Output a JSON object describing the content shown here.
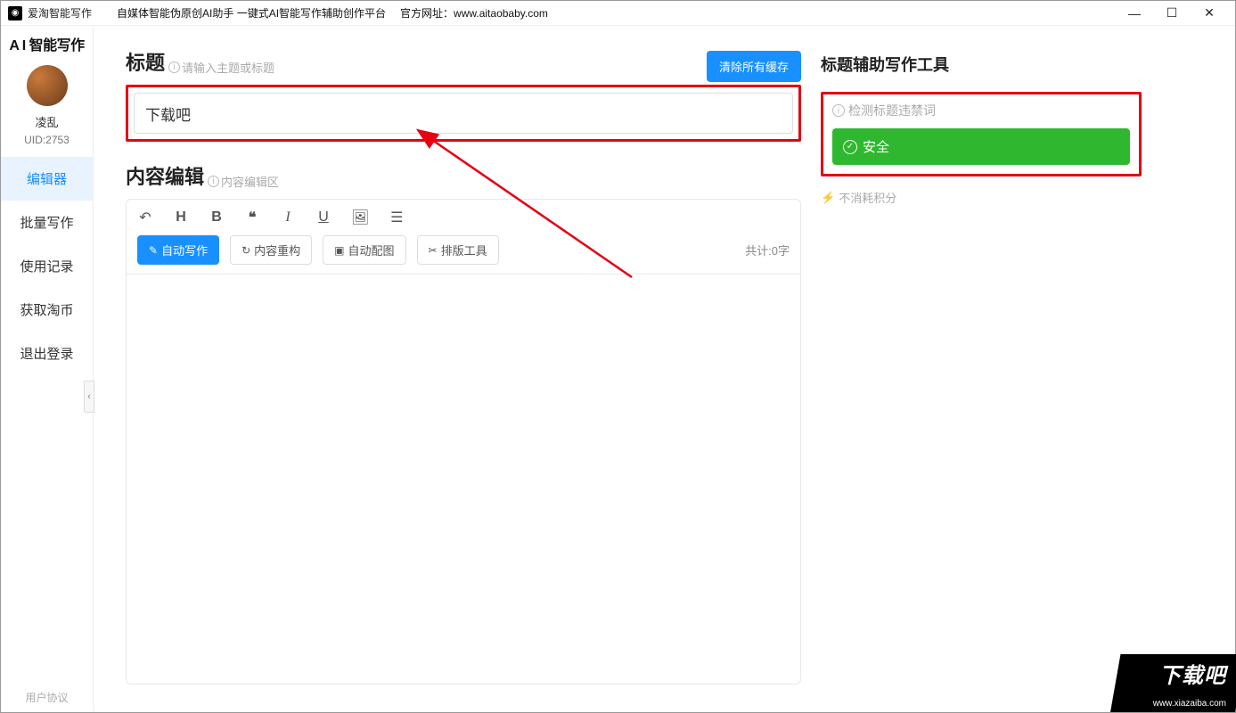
{
  "titlebar": {
    "app_name": "爱淘智能写作",
    "subtitle": "自媒体智能伪原创AI助手   一键式AI智能写作辅助创作平台",
    "official_label": "官方网址：",
    "official_url": "www.aitaobaby.com"
  },
  "sidebar": {
    "brand": "A I 智能写作",
    "username": "凌乱",
    "uid": "UID:2753",
    "nav": [
      {
        "label": "编辑器",
        "active": true
      },
      {
        "label": "批量写作",
        "active": false
      },
      {
        "label": "使用记录",
        "active": false
      },
      {
        "label": "获取淘币",
        "active": false
      },
      {
        "label": "退出登录",
        "active": false
      }
    ],
    "footer": "用户协议"
  },
  "title_section": {
    "heading": "标题",
    "hint": "请输入主题或标题",
    "clear_btn": "清除所有缓存",
    "input_value": "下载吧"
  },
  "content_section": {
    "heading": "内容编辑",
    "hint": "内容编辑区",
    "buttons": {
      "auto_write": "自动写作",
      "restructure": "内容重构",
      "auto_image": "自动配图",
      "layout_tool": "排版工具"
    },
    "counter": "共计:0字"
  },
  "right_panel": {
    "heading": "标题辅助写作工具",
    "check_label": "检测标题违禁词",
    "safe_status": "安全",
    "points": "不消耗积分"
  },
  "watermark": {
    "text": "下载吧",
    "url": "www.xiazaiba.com"
  }
}
